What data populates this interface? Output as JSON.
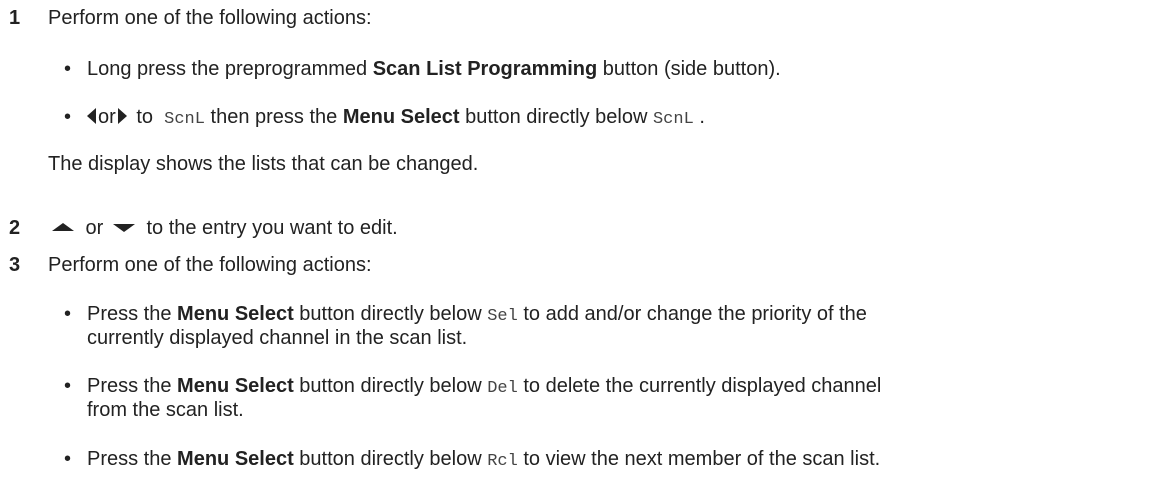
{
  "steps": [
    {
      "number": "1",
      "text": "Perform one of the following actions:",
      "bullets": [
        {
          "t1": "Long press the preprogrammed ",
          "b1": "Scan List Programming",
          "t2": " button (side button)."
        },
        {
          "or": "or",
          "to": " to ",
          "m1": "ScnL",
          "then": " then press the ",
          "b1": "Menu Select",
          "below": " button directly below ",
          "m2": "ScnL",
          "end": " ."
        }
      ],
      "after": "The display shows the lists that can be changed."
    },
    {
      "number": "2",
      "or": " or ",
      "text": " to the entry you want to edit."
    },
    {
      "number": "3",
      "text": "Perform one of the following actions:",
      "bullets": [
        {
          "pre": "Press the ",
          "bold": "Menu Select",
          "mid": " button directly below ",
          "mono": "Sel",
          "post": " to add and/or change the priority of the",
          "cont": "currently displayed channel in the scan list."
        },
        {
          "pre": "Press the ",
          "bold": "Menu Select",
          "mid": " button directly below ",
          "mono": "Del",
          "post": " to delete the currently displayed channel",
          "cont": "from the scan list."
        },
        {
          "pre": "Press the ",
          "bold": "Menu Select",
          "mid": " button directly below ",
          "mono": "Rcl",
          "post": " to view the next member of the scan list."
        }
      ]
    }
  ],
  "icons": {
    "left": "left-arrow-icon",
    "right": "right-arrow-icon",
    "up": "up-arrow-icon",
    "down": "down-arrow-icon"
  },
  "bullet_char": "•"
}
